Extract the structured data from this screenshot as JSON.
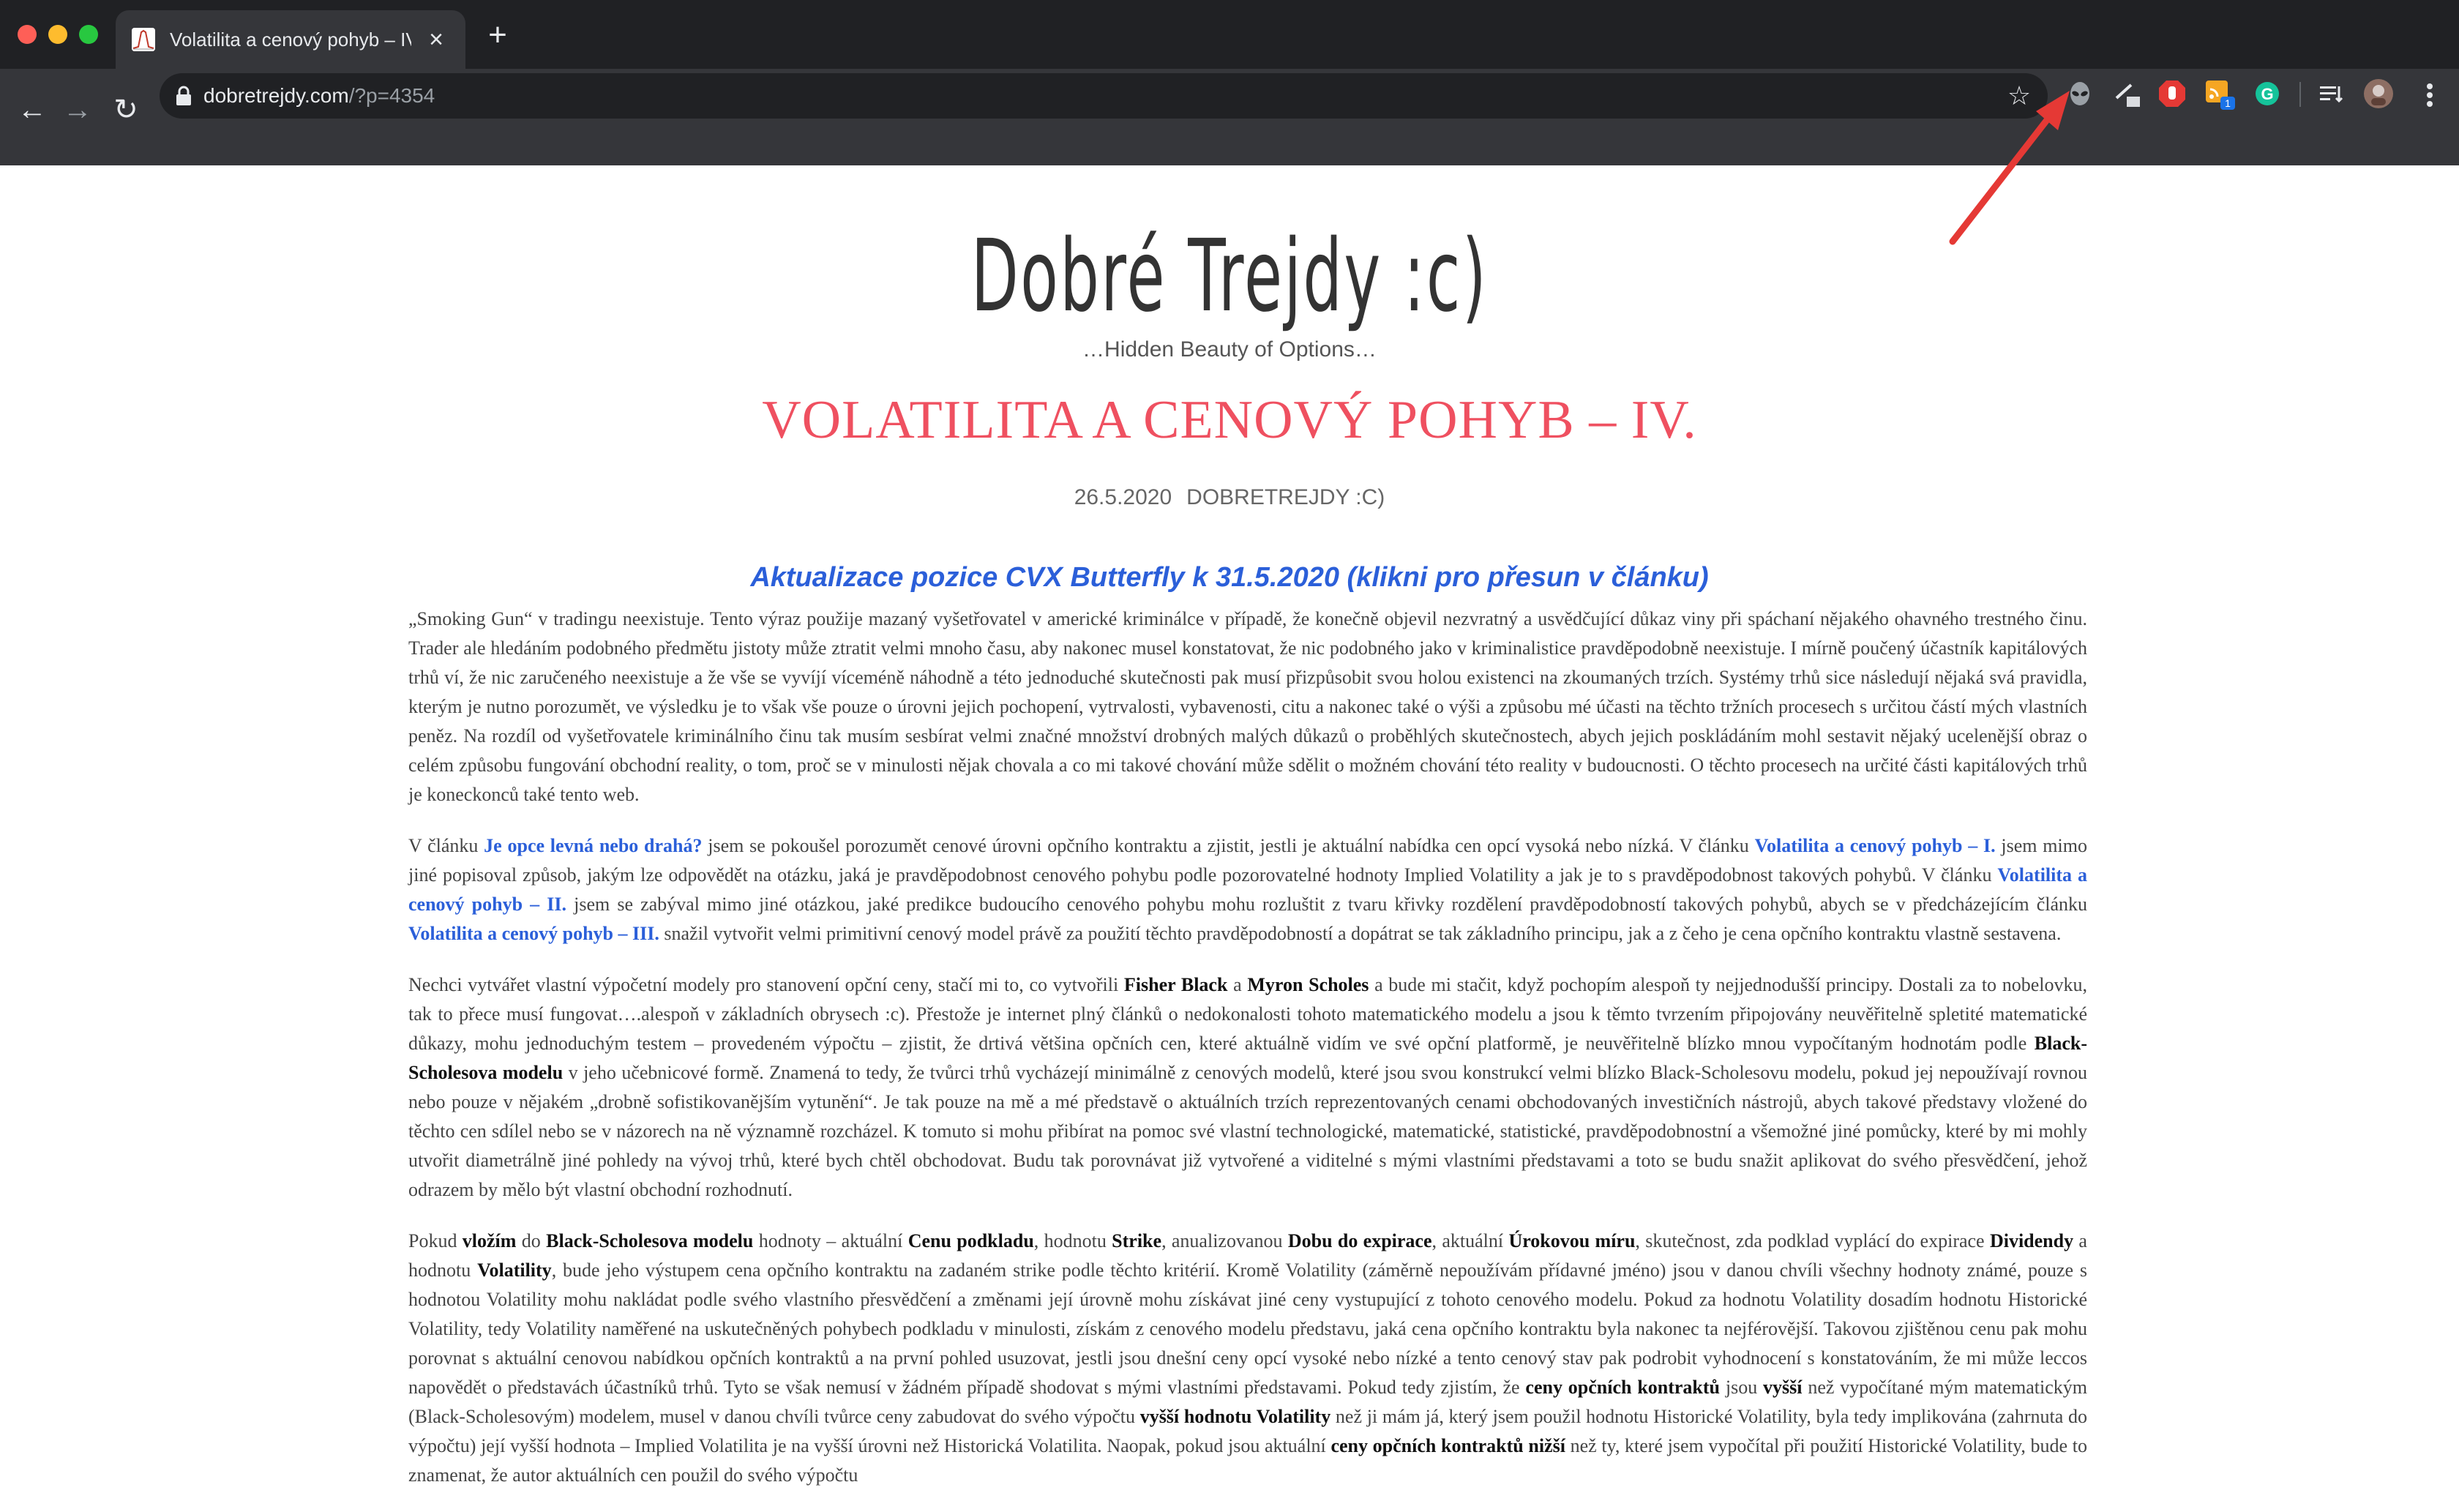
{
  "browser": {
    "tab": {
      "title": "Volatilita a cenový pohyb – IV.",
      "close_glyph": "×"
    },
    "new_tab_glyph": "+",
    "nav": {
      "back_glyph": "←",
      "forward_glyph": "→",
      "reload_glyph": "↻"
    },
    "address": {
      "host": "dobretrejdy.com",
      "path": "/?p=4354"
    },
    "bookmark_glyph": "☆",
    "extensions": [
      "alien-extension-icon",
      "pen-extension-icon",
      "adblock-icon",
      "rss-extension-icon",
      "grammarly-icon",
      "reading-list-icon",
      "profile-avatar"
    ],
    "extension_badge": "1",
    "colors": {
      "chrome_dark": "#202124",
      "toolbar": "#35363a",
      "annotation_arrow": "#e53935"
    }
  },
  "site": {
    "title": "Dobré Trejdy :c)",
    "tagline": "…Hidden Beauty of Options…"
  },
  "post": {
    "title": "VOLATILITA A CENOVÝ POHYB – IV.",
    "date": "26.5.2020",
    "author": "DOBRETREJDY :C)",
    "update_link": "Aktualizace pozice CVX Butterfly k 31.5.2020 (klikni pro přesun v článku)",
    "colors": {
      "title": "#ef5060",
      "link": "#2b5fd9"
    }
  },
  "article": {
    "p1": "„Smoking Gun“ v tradingu neexistuje. Tento výraz použije mazaný vyšetřovatel v americké kriminálce v případě, že konečně objevil nezvratný a usvědčující důkaz viny při spáchaní nějakého ohavného trestného činu. Trader ale hledáním podobného předmětu jistoty může ztratit velmi mnoho času, aby nakonec musel konstatovat, že nic podobného jako v kriminalistice pravděpodobně neexistuje. I mírně poučený účastník kapitálových trhů ví, že nic zaručeného neexistuje a že vše se vyvíjí víceméně náhodně a této jednoduché skutečnosti pak musí přizpůsobit svou holou existenci na zkoumaných trzích. Systémy trhů sice následují nějaká svá pravidla, kterým je nutno porozumět, ve výsledku je to však vše pouze o úrovni jejich pochopení, vytrvalosti, vybavenosti, citu a nakonec také o výši a způsobu mé účasti na těchto tržních procesech s určitou částí mých vlastních peněz. Na rozdíl od vyšetřovatele kriminálního činu tak musím sesbírat velmi značné množství drobných malých důkazů o proběhlých skutečnostech, abych jejich poskládáním mohl sestavit nějaký ucelenější obraz o celém způsobu fungování obchodní reality, o tom, proč se v minulosti nějak chovala a co mi takové chování může sdělit o možném chování této reality v budoucnosti. O těchto procesech na určité části kapitálových trhů je koneckonců také tento web.",
    "p2": {
      "t1": " V článku ",
      "l1": "Je opce levná nebo drahá?",
      "t2": " jsem se pokoušel porozumět cenové úrovni opčního kontraktu a zjistit, jestli je aktuální nabídka cen opcí vysoká nebo nízká. V článku ",
      "l2": "Volatilita a cenový pohyb – I.",
      "t3": " jsem mimo jiné popisoval způsob, jakým lze odpovědět na otázku, jaká je pravděpodobnost cenového pohybu podle pozorovatelné hodnoty Implied Volatility a jak je to s pravděpodobnost takových pohybů. V článku ",
      "l3": "Volatilita a cenový pohyb – II.",
      "t4": " jsem se zabýval mimo jiné otázkou, jaké predikce budoucího cenového pohybu mohu rozluštit z tvaru křivky rozdělení pravděpodobností takových pohybů, abych se v předcházejícím článku ",
      "l4": "Volatilita a cenový pohyb – III.",
      "t5": " snažil vytvořit velmi primitivní cenový model právě za použití těchto pravděpodobností a dopátrat se tak základního principu, jak a z čeho je cena opčního kontraktu vlastně sestavena."
    },
    "p3": {
      "t1": "  Nechci vytvářet vlastní výpočetní modely pro stanovení opční ceny, stačí mi to, co vytvořili ",
      "b1": "Fisher Black",
      "t2": " a ",
      "b2": "Myron Scholes",
      "t3": " a bude mi stačit, když pochopím alespoň ty nejjednodušší principy. Dostali za to nobelovku, tak to přece musí fungovat….alespoň v základních obrysech :c). Přestože je internet plný článků o nedokonalosti tohoto matematického modelu a jsou k těmto tvrzením připojovány neuvěřitelně spletité matematické důkazy, mohu jednoduchým testem – provedeném výpočtu – zjistit, že drtivá většina opčních cen, které aktuálně vidím ve své opční platformě, je neuvěřitelně blízko mnou vypočítaným hodnotám podle ",
      "b3": "Black-Scholesova modelu",
      "t4": " v jeho učebnicové formě. Znamená to tedy, že tvůrci trhů vycházejí minimálně z cenových modelů, které jsou svou konstrukcí velmi blízko Black-Scholesovu modelu, pokud jej nepoužívají rovnou nebo pouze v nějakém „drobně sofistikovanějším vytunění“. Je tak pouze na mě a mé představě o aktuálních trzích reprezentovaných cenami obchodovaných investičních nástrojů, abych takové představy vložené do těchto cen sdílel nebo se v názorech na ně významně rozcházel. K tomuto si mohu přibírat na pomoc své vlastní technologické, matematické, statistické, pravděpodobnostní a všemožné jiné pomůcky, které by mi mohly utvořit diametrálně jiné pohledy na vývoj trhů, které bych chtěl obchodovat. Budu tak porovnávat již vytvořené a viditelné s mými vlastními představami a toto se budu snažit aplikovat do svého přesvědčení, jehož odrazem by mělo být vlastní obchodní rozhodnutí."
    },
    "p4": {
      "t1": "  Pokud ",
      "b1": "vložím",
      "t2": " do ",
      "b2": "Black-Scholesova modelu",
      "t3": " hodnoty – aktuální ",
      "b3": "Cenu podkladu",
      "t4": ", hodnotu ",
      "b4": "Strike",
      "t5": ", anualizovanou ",
      "b5": "Dobu do expirace",
      "t6": ", aktuální ",
      "b6": "Úrokovou míru",
      "t7": ", skutečnost, zda podklad vyplácí do expirace ",
      "b7": "Dividendy",
      "t8": " a hodnotu ",
      "b8": "Volatility",
      "t9": ", bude jeho výstupem cena opčního kontraktu na zadaném strike podle těchto kritérií. Kromě Volatility (záměrně nepoužívám přídavné jméno) jsou v danou chvíli všechny hodnoty známé, pouze s hodnotou Volatility mohu nakládat podle svého vlastního přesvědčení a změnami její úrovně mohu získávat jiné ceny vystupující z tohoto cenového modelu. Pokud za hodnotu Volatility dosadím hodnotu Historické Volatility, tedy Volatility naměřené na uskutečněných pohybech podkladu v minulosti, získám z cenového modelu představu, jaká cena opčního kontraktu byla nakonec ta nejférovější. Takovou zjištěnou cenu pak mohu porovnat s aktuální cenovou nabídkou opčních kontraktů a na první pohled usuzovat, jestli jsou dnešní ceny opcí vysoké nebo nízké a tento cenový stav pak podrobit vyhodnocení s konstatováním, že mi může leccos napovědět o představách účastníků trhů. Tyto se však nemusí v žádném případě shodovat s mými vlastními představami. Pokud tedy zjistím, že ",
      "b9": "ceny opčních kontraktů",
      "t10": " jsou ",
      "b10": "vyšší",
      "t11": " než vypočítané mým matematickým (Black-Scholesovým) modelem, musel v danou chvíli tvůrce ceny zabudovat do svého výpočtu ",
      "b11": "vyšší hodnotu Volatility",
      "t12": " než ji mám já, který jsem použil hodnotu Historické Volatility, byla tedy implikována (zahrnuta do výpočtu) její vyšší hodnota – Implied Volatilita je na vyšší úrovni než Historická Volatilita. Naopak, pokud jsou aktuální ",
      "b12": "ceny opčních kontraktů nižší",
      "t13": " než ty, které jsem vypočítal při použití Historické Volatility, bude to znamenat, že autor aktuálních cen použil do svého výpočtu"
    }
  }
}
